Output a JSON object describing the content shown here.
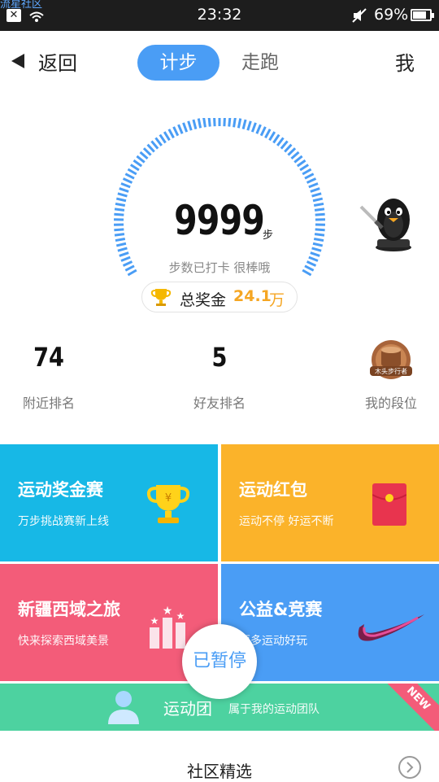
{
  "status_bar": {
    "watermark": "流星社区",
    "time": "23:32",
    "battery": "69%"
  },
  "nav": {
    "back_label": "返回",
    "tabs": [
      "计步",
      "走跑"
    ],
    "active_tab": "计步",
    "me_label": "我"
  },
  "steps": {
    "count": "9999",
    "unit": "步",
    "checked_text": "步数已打卡  很棒哦"
  },
  "bonus": {
    "label": "总奖金",
    "amount": "24.1",
    "unit": "万"
  },
  "stats": [
    {
      "value": "74",
      "label": "附近排名"
    },
    {
      "value": "5",
      "label": "好友排名"
    },
    {
      "value": "",
      "label": "我的段位",
      "badge_text": "木头步行者"
    }
  ],
  "tiles": [
    {
      "title": "运动奖金赛",
      "subtitle": "万步挑战赛新上线",
      "icon": "trophy-icon"
    },
    {
      "title": "运动红包",
      "subtitle": "运动不停 好运不断",
      "icon": "red-envelope-icon"
    },
    {
      "title": "新疆西域之旅",
      "subtitle": "快来探索西域美景",
      "icon": "podium-icon"
    },
    {
      "title": "公益&竞赛",
      "subtitle": "更多运动好玩",
      "icon": "swoosh-icon"
    }
  ],
  "team": {
    "title": "运动团",
    "subtitle": "属于我的运动团队",
    "ribbon": "NEW"
  },
  "pause_label": "已暂停",
  "community": {
    "title": "社区精选"
  },
  "colors": {
    "accent": "#4a9df5",
    "gold": "#f5a623",
    "cyan": "#17b8e6",
    "orange": "#fbb32a",
    "pink": "#f35c79",
    "green": "#4dd2a0"
  }
}
